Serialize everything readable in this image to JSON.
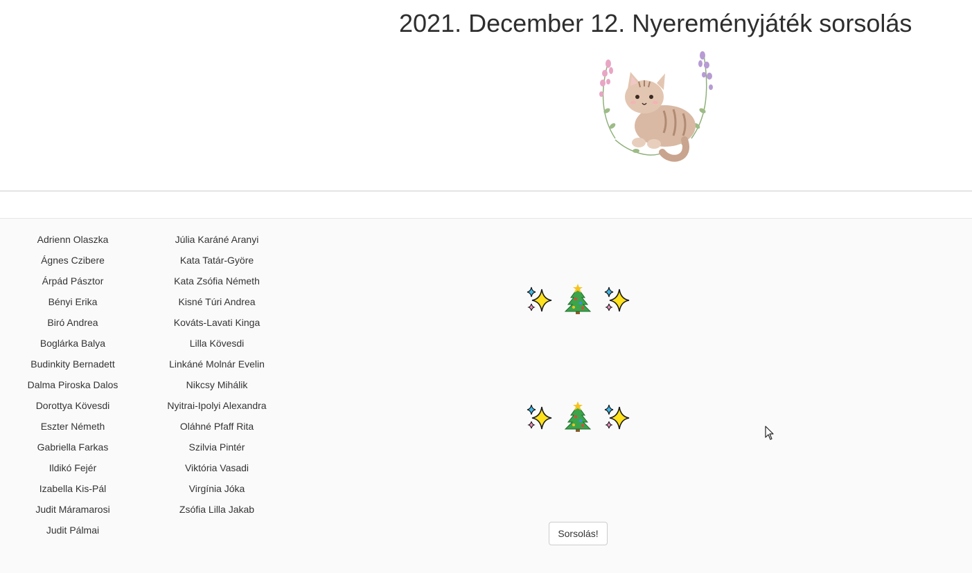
{
  "header": {
    "title": "2021. December 12. Nyereményjáték sorsolás",
    "logo_icon": "cat-wreath-logo-icon"
  },
  "participants": {
    "column1": [
      "Adrienn Olaszka",
      "Ágnes Czibere",
      "Árpád Pásztor",
      "Bényi Erika",
      "Biró Andrea",
      "Boglárka Balya",
      "Budinkity Bernadett",
      "Dalma Piroska Dalos",
      "Dorottya Kövesdi",
      "Eszter Németh",
      "Gabriella Farkas",
      "Ildikó Fejér",
      "Izabella Kis-Pál",
      "Judit Máramarosi",
      "Judit Pálmai"
    ],
    "column2": [
      "Júlia Karáné Aranyi",
      "Kata Tatár-Györe",
      "Kata Zsófia Németh",
      "Kisné Túri Andrea",
      "Kováts-Lavati Kinga",
      "Lilla Kövesdi",
      "Linkáné Molnár Evelin",
      "Nikcsy Mihálik",
      "Nyitrai-Ipolyi Alexandra",
      "Oláhné Pfaff Rita",
      "Szilvia Pintér",
      "Viktória Vasadi",
      "Virgínia Jóka",
      "Zsófia Lilla Jakab"
    ]
  },
  "slots": [
    {
      "icons": [
        "sparkles-icon",
        "christmas-tree-icon",
        "sparkles-icon"
      ]
    },
    {
      "icons": [
        "sparkles-icon",
        "christmas-tree-icon",
        "sparkles-icon"
      ]
    }
  ],
  "draw_button": {
    "label": "Sorsolás!"
  },
  "colors": {
    "title": "#2e2e2e",
    "text": "#333333",
    "main_bg": "#fafafa",
    "divider": "#e4e4e4",
    "sparkle_yellow": "#ffe11e",
    "sparkle_blue": "#3fb8e8",
    "sparkle_pink": "#f08fc0",
    "tree_green": "#3aa54a",
    "star_gold": "#f7c21e"
  }
}
